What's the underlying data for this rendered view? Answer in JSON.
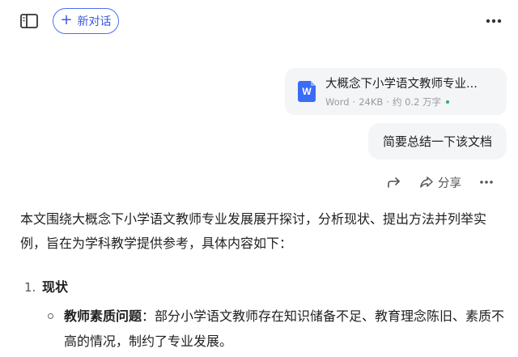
{
  "header": {
    "new_chat_label": "新对话"
  },
  "file": {
    "name": "大概念下小学语文教师专业...",
    "type": "Word",
    "size": "24KB",
    "words": "约 0.2 万字",
    "separator": "·"
  },
  "user_message": "简要总结一下该文档",
  "actions": {
    "share_label": "分享"
  },
  "answer": {
    "intro": "本文围绕大概念下小学语文教师专业发展展开探讨，分析现状、提出方法并列举实例，旨在为学科教学提供参考，具体内容如下：",
    "sections": [
      {
        "number": "1.",
        "title": "现状",
        "items": [
          {
            "heading": "教师素质问题",
            "separator": "：",
            "text": "部分小学语文教师存在知识储备不足、教育理念陈旧、素质不高的情况，制约了专业发展。"
          }
        ]
      }
    ]
  },
  "icons": {
    "sidebar": "sidebar-panel-icon",
    "plus": "plus-icon",
    "more": "more-horizontal-icon",
    "word": "word-doc-icon",
    "forward": "forward-arrow-icon",
    "share": "share-icon"
  },
  "colors": {
    "accent": "#3b5bdb",
    "word_blue": "#3b6cf6",
    "bubble_bg": "#f4f5f7",
    "status_green": "#22b35e"
  }
}
